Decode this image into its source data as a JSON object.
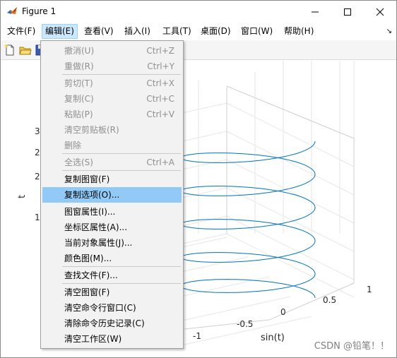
{
  "window": {
    "title": "Figure 1",
    "app_icon": "matlab-icon",
    "controls": [
      "minimize-icon",
      "maximize-icon",
      "close-icon"
    ]
  },
  "menubar": {
    "items": [
      {
        "label": "文件(F)"
      },
      {
        "label": "编辑(E)"
      },
      {
        "label": "查看(V)"
      },
      {
        "label": "插入(I)"
      },
      {
        "label": "工具(T)"
      },
      {
        "label": "桌面(D)"
      },
      {
        "label": "窗口(W)"
      },
      {
        "label": "帮助(H)"
      }
    ],
    "arrow": "↘"
  },
  "toolbar": {
    "icons": [
      "new-figure-icon",
      "open-file-icon",
      "save-icon"
    ]
  },
  "edit_menu": {
    "items": [
      {
        "label": "撤消(U)",
        "shortcut": "Ctrl+Z",
        "enabled": false
      },
      {
        "label": "重做(R)",
        "shortcut": "Ctrl+Y",
        "enabled": false
      },
      {
        "label": "剪切(T)",
        "shortcut": "Ctrl+X",
        "enabled": false
      },
      {
        "label": "复制(C)",
        "shortcut": "Ctrl+C",
        "enabled": false
      },
      {
        "label": "粘贴(P)",
        "shortcut": "Ctrl+V",
        "enabled": false
      },
      {
        "label": "清空剪贴板(R)",
        "shortcut": "",
        "enabled": false
      },
      {
        "label": "删除",
        "shortcut": "",
        "enabled": false
      },
      {
        "label": "全选(S)",
        "shortcut": "Ctrl+A",
        "enabled": false
      },
      {
        "label": "复制图窗(F)",
        "shortcut": "",
        "enabled": true
      },
      {
        "label": "复制选项(O)...",
        "shortcut": "",
        "enabled": true,
        "highlighted": true
      },
      {
        "label": "图窗属性(I)...",
        "shortcut": "",
        "enabled": true
      },
      {
        "label": "坐标区属性(A)...",
        "shortcut": "",
        "enabled": true
      },
      {
        "label": "当前对象属性(J)...",
        "shortcut": "",
        "enabled": true
      },
      {
        "label": "颜色图(M)...",
        "shortcut": "",
        "enabled": true
      },
      {
        "label": "查找文件(F)...",
        "shortcut": "",
        "enabled": true
      },
      {
        "label": "清空图窗(F)",
        "shortcut": "",
        "enabled": true
      },
      {
        "label": "清空命令行窗口(C)",
        "shortcut": "",
        "enabled": true
      },
      {
        "label": "清除命令历史记录(C)",
        "shortcut": "",
        "enabled": true
      },
      {
        "label": "清空工作区(W)",
        "shortcut": "",
        "enabled": true
      }
    ]
  },
  "axes": {
    "zlabel": "t",
    "xlabel": "sin(t)",
    "z_ticks_visible": [
      "3",
      "2",
      "2",
      "1"
    ],
    "x_ticks": [
      "1",
      "0.5",
      "0",
      "-0.5",
      "-1"
    ],
    "line_color": "#0072bd"
  },
  "watermark": "CSDN @铅笔！！"
}
